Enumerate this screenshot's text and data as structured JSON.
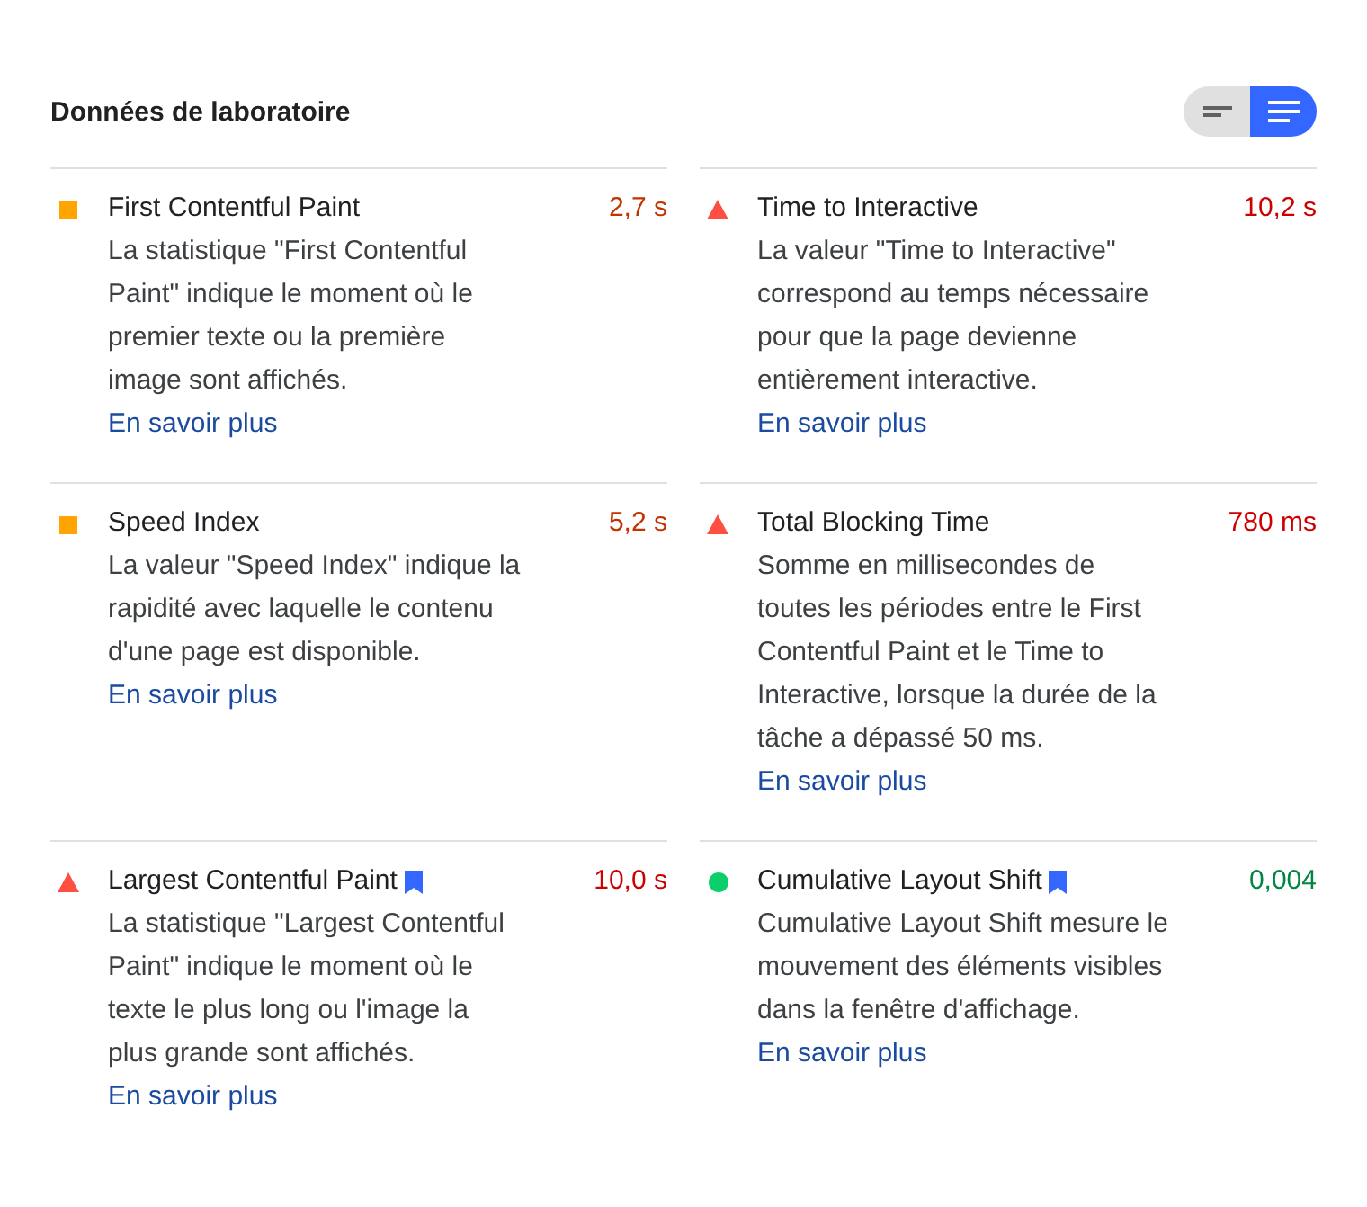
{
  "title": "Données de laboratoire",
  "view_toggle": [
    {
      "kind": "compact",
      "selected": false
    },
    {
      "kind": "expanded",
      "selected": true
    }
  ],
  "metrics": [
    {
      "name": "First Contentful Paint",
      "kind": "average",
      "value": "2,7 s",
      "bookmarked": false,
      "description": "La statistique \"First Contentful Paint\" indique le moment où le premier texte ou la première image sont affichés.",
      "link": "En savoir plus"
    },
    {
      "name": "Time to Interactive",
      "kind": "fail",
      "value": "10,2 s",
      "bookmarked": false,
      "description": "La valeur \"Time to Interactive\" correspond au temps nécessaire pour que la page devienne entièrement interactive.",
      "link": "En savoir plus"
    },
    {
      "name": "Speed Index",
      "kind": "average",
      "value": "5,2 s",
      "bookmarked": false,
      "description": "La valeur \"Speed Index\" indique la rapidité avec laquelle le contenu d'une page est disponible.",
      "link": "En savoir plus"
    },
    {
      "name": "Total Blocking Time",
      "kind": "fail",
      "value": "780 ms",
      "bookmarked": false,
      "description": "Somme en millisecondes de toutes les périodes entre le First Contentful Paint et le Time to Interactive, lorsque la durée de la tâche a dépassé 50 ms.",
      "link": "En savoir plus"
    },
    {
      "name": "Largest Contentful Paint",
      "kind": "fail",
      "value": "10,0 s",
      "bookmarked": true,
      "description": "La statistique \"Largest Contentful Paint\" indique le moment où le texte le plus long ou l'image la plus grande sont affichés.",
      "link": "En savoir plus"
    },
    {
      "name": "Cumulative Layout Shift",
      "kind": "pass",
      "value": "0,004",
      "bookmarked": true,
      "description": "Cumulative Layout Shift mesure le mouvement des éléments visibles dans la fenêtre d'affichage.",
      "link": "En savoir plus"
    }
  ]
}
